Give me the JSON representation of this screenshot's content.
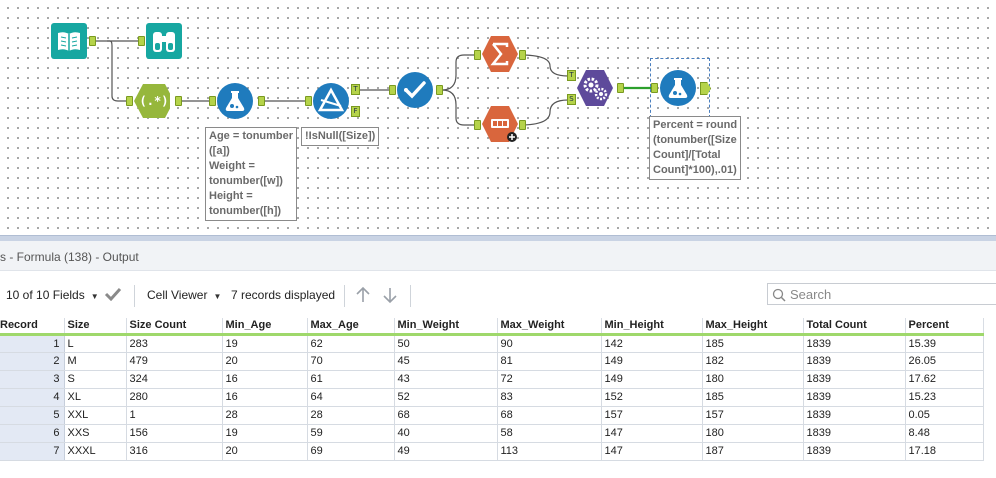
{
  "canvas": {
    "annotations": {
      "formula1": [
        "Age = tonumber",
        "([a])",
        "Weight =",
        "tonumber([w])",
        "Height =",
        "tonumber([h])"
      ],
      "filter": "!IsNull([Size])",
      "formula2": [
        "Percent = round",
        "(tonumber([Size",
        "Count]/[Total",
        "Count]*100),.01)"
      ]
    },
    "anchor_labels": {
      "filter_true": "T",
      "filter_false": "F",
      "join_top": "T",
      "join_bottom": "S"
    },
    "regex_glyph": "(.*)",
    "icons": {
      "input": "book-icon",
      "browse": "binoculars-icon",
      "regex": "regex-icon",
      "formula": "flask-icon",
      "filter": "filter-triangle-icon",
      "select": "checkmark-icon",
      "summarize": "sigma-icon",
      "count": "counter-icon",
      "append": "gears-icon"
    }
  },
  "results": {
    "title": "s - Formula (138) - Output",
    "fields_label": "10 of 10 Fields",
    "viewer_label": "Cell Viewer",
    "records_label": "7 records displayed",
    "search_placeholder": "Search"
  },
  "table": {
    "columns": [
      "Record",
      "Size",
      "Size Count",
      "Min_Age",
      "Max_Age",
      "Min_Weight",
      "Max_Weight",
      "Min_Height",
      "Max_Height",
      "Total Count",
      "Percent"
    ],
    "rows": [
      [
        "1",
        "L",
        "283",
        "19",
        "62",
        "50",
        "90",
        "142",
        "185",
        "1839",
        "15.39"
      ],
      [
        "2",
        "M",
        "479",
        "20",
        "70",
        "45",
        "81",
        "149",
        "182",
        "1839",
        "26.05"
      ],
      [
        "3",
        "S",
        "324",
        "16",
        "61",
        "43",
        "72",
        "149",
        "180",
        "1839",
        "17.62"
      ],
      [
        "4",
        "XL",
        "280",
        "16",
        "64",
        "52",
        "83",
        "152",
        "185",
        "1839",
        "15.23"
      ],
      [
        "5",
        "XXL",
        "1",
        "28",
        "28",
        "68",
        "68",
        "157",
        "157",
        "1839",
        "0.05"
      ],
      [
        "6",
        "XXS",
        "156",
        "19",
        "59",
        "40",
        "58",
        "147",
        "180",
        "1839",
        "8.48"
      ],
      [
        "7",
        "XXXL",
        "316",
        "20",
        "69",
        "49",
        "113",
        "147",
        "187",
        "1839",
        "17.18"
      ]
    ]
  },
  "colors": {
    "accent_green": "#9fd86b",
    "tool_teal": "#17a7a1",
    "tool_blue": "#1f7bbd",
    "tool_olive": "#96b73c",
    "tool_orange": "#d9663d",
    "tool_purple": "#5e4a9b"
  }
}
